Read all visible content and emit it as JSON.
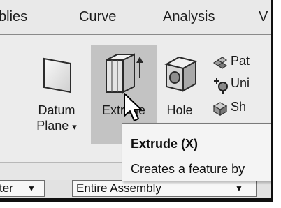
{
  "menubar": {
    "items": [
      {
        "label": "blies"
      },
      {
        "label": "Curve"
      },
      {
        "label": "Analysis"
      },
      {
        "label": "V"
      }
    ]
  },
  "ribbon": {
    "datum_plane": {
      "line1": "Datum",
      "line2": "Plane",
      "dropdown": "▾",
      "icon": "datum-plane-icon"
    },
    "extrude": {
      "label": "Extrude",
      "icon": "extrude-icon",
      "state": "hovered"
    },
    "hole": {
      "label": "Hole",
      "icon": "hole-icon"
    },
    "side_items": [
      {
        "label": "Pat",
        "icon": "pattern-icon"
      },
      {
        "label": "Uni",
        "icon": "unite-icon"
      },
      {
        "label": "Sh",
        "icon": "shell-icon"
      }
    ]
  },
  "tooltip": {
    "title": "Extrude (X)",
    "description": "Creates a feature by"
  },
  "filterbar": {
    "type_filter": {
      "value": "ter",
      "arrow": "▼"
    },
    "scope_filter": {
      "value": "Entire Assembly",
      "arrow": "▼"
    }
  },
  "colors": {
    "ribbon_bg": "#ececec",
    "hover_bg": "#c3c3c3",
    "tooltip_bg": "#f4f4f4",
    "frame_border": "#101010"
  }
}
